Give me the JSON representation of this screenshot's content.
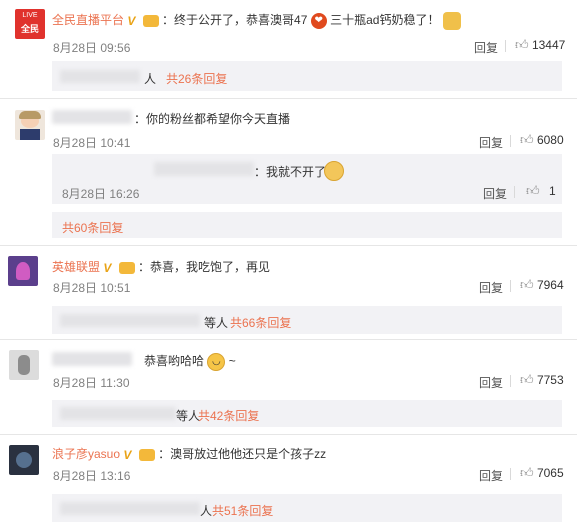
{
  "comments": [
    {
      "name": "全民直播平台",
      "text": "：终于公开了，恭喜澳哥47",
      "text_tail": "三十瓶ad钙奶稳了！",
      "time": "8月28日 09:56",
      "reply": "回复",
      "likes": "13447",
      "more": "人",
      "more_link": "共26条回复",
      "avatar_text": "全民",
      "avatar_live": "LIVE"
    },
    {
      "text": "：你的粉丝都希望你今天直播",
      "time": "8月28日 10:41",
      "reply": "回复",
      "likes": "6080",
      "sub_reply": {
        "text": "：我就不开了",
        "time": "8月28日 16:26",
        "reply": "回复",
        "likes": "1"
      },
      "more_link": "共60条回复"
    },
    {
      "name": "英雄联盟",
      "text": "：恭喜，我吃饱了，再见",
      "time": "8月28日 10:51",
      "reply": "回复",
      "likes": "7964",
      "more": "等人",
      "more_link": "共66条回复"
    },
    {
      "text": "恭喜哟哈哈",
      "text_tail": "~",
      "time": "8月28日 11:30",
      "reply": "回复",
      "likes": "7753",
      "more": "等人",
      "more_link": "共42条回复"
    },
    {
      "name": "浪子彦yasuo",
      "text": "：澳哥放过他他还只是个孩子zz",
      "time": "8月28日 13:16",
      "reply": "回复",
      "likes": "7065",
      "more": "人",
      "more_link": "共51条回复"
    }
  ],
  "colors": {
    "accent": "#eb7350",
    "text": "#333333",
    "muted": "#808080",
    "sub_bg": "#f2f2f5",
    "verified": "#e9a316"
  },
  "icons": {
    "like": "thumbs-up-icon",
    "verified": "verified-v-icon",
    "vip": "vip-crown-icon",
    "heart": "heart-emoji",
    "dog": "doge-emoji",
    "gold": "gold-emoji",
    "smile": "laugh-emoji"
  }
}
